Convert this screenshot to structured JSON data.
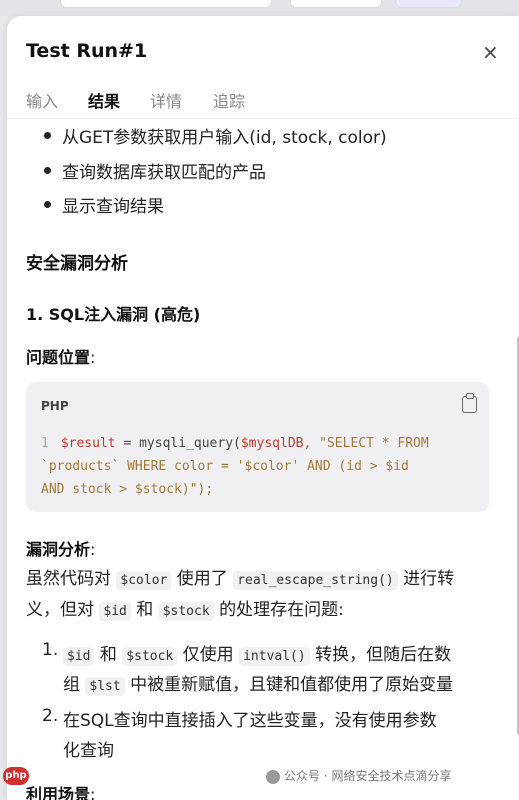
{
  "window": {
    "title": "Test Run#1",
    "close_glyph": "×"
  },
  "tabs": [
    {
      "label": "输入",
      "active": false
    },
    {
      "label": "结果",
      "active": true
    },
    {
      "label": "详情",
      "active": false
    },
    {
      "label": "追踪",
      "active": false
    }
  ],
  "content": {
    "bullets": [
      "从GET参数获取用户输入(id, stock, color)",
      "查询数据库获取匹配的产品",
      "显示查询结果"
    ],
    "section_title": "安全漏洞分析",
    "vuln_title": "1. SQL注入漏洞 (高危)",
    "location_label": "问题位置",
    "location_colon": ":",
    "code": {
      "lang": "PHP",
      "line_number": "1",
      "line1_var": "$result",
      "line1_eq": " = ",
      "line1_fn": "mysqli_query(",
      "line1_var2": "$mysqlDB",
      "line1_str": ", \"SELECT * FROM",
      "line2": "`products` WHERE color = '$color' AND (id > $id",
      "line3": "AND stock > $stock)\");"
    },
    "analysis_label": "漏洞分析",
    "analysis_colon": ":",
    "analysis_p1_a": "虽然代码对",
    "analysis_p1_code1": "$color",
    "analysis_p1_b": "使用了",
    "analysis_p1_code2": "real_escape_string()",
    "analysis_p1_c": "进行转",
    "analysis_p2_a": "义，但对",
    "analysis_p2_code1": "$id",
    "analysis_p2_b": "和",
    "analysis_p2_code2": "$stock",
    "analysis_p2_c": "的处理存在问题:",
    "ol": [
      {
        "num": "1.",
        "code1": "$id",
        "t1": "和",
        "code2": "$stock",
        "t2": "仅使用",
        "code3": "intval()",
        "t3": "转换，但随后在数",
        "l2a": "组",
        "code4": "$lst",
        "l2b": "中被重新赋值，且键和值都使用了原始变量"
      },
      {
        "num": "2.",
        "t1": "在SQL查询中直接插入了这些变量，没有使用参数",
        "t2": "化查询"
      }
    ],
    "trailing_label": "利用场景",
    "trailing_colon": ":"
  },
  "watermark": {
    "text": "公众号 · 网络安全技术点滴分享"
  },
  "phplogo": {
    "text": "php"
  }
}
